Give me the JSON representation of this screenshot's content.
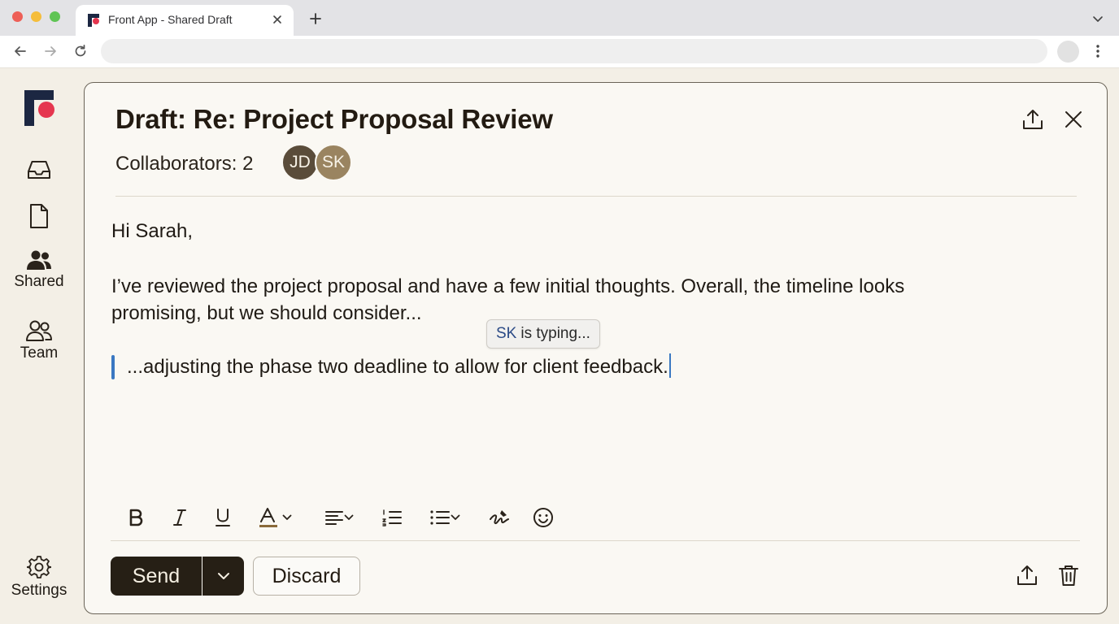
{
  "browser": {
    "tab_title": "Front App - Shared Draft",
    "address": ""
  },
  "sidebar": {
    "items": [
      {
        "icon": "inbox-icon",
        "label": ""
      },
      {
        "icon": "document-icon",
        "label": ""
      },
      {
        "icon": "shared-people-icon",
        "label": "Shared"
      },
      {
        "icon": "team-icon",
        "label": "Team"
      }
    ],
    "settings_label": "Settings"
  },
  "draft": {
    "title": "Draft: Re: Project Proposal Review",
    "collaborators_label": "Collaborators: 2",
    "collaborators": [
      {
        "initials": "JD",
        "color": "#5a4c3a"
      },
      {
        "initials": "SK",
        "color": "#9a8460"
      }
    ],
    "body": {
      "greeting": "Hi Sarah,",
      "paragraph1": "I’ve reviewed the project proposal and have a few initial thoughts. Overall, the timeline looks promising, but we should consider...",
      "paragraph2": "...adjusting the phase two deadline to allow for client feedback."
    },
    "typing_indicator": {
      "who": "SK",
      "text": "is typing..."
    }
  },
  "footer": {
    "send_label": "Send",
    "discard_label": "Discard"
  },
  "colors": {
    "accent_dark": "#261f15",
    "cursor_blue": "#3a78c2",
    "brand_red": "#e5364f",
    "brand_navy": "#1c2742"
  }
}
